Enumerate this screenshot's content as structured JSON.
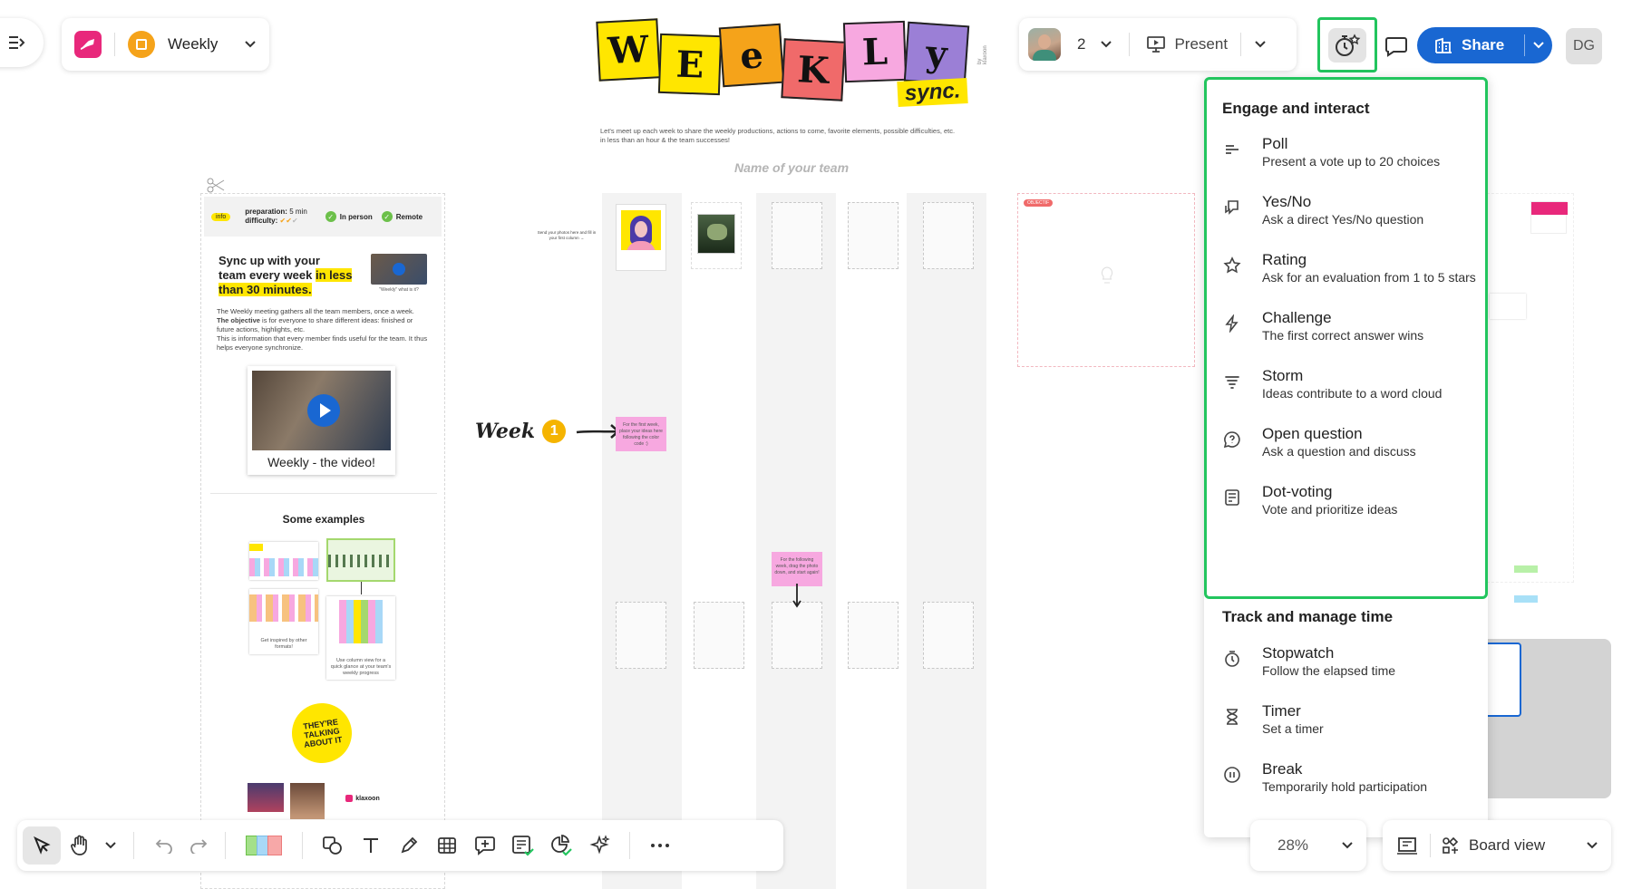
{
  "board": {
    "name": "Weekly"
  },
  "header": {
    "collaborators_count": "2",
    "present_label": "Present",
    "share_label": "Share",
    "user_initials": "DG"
  },
  "banner": {
    "letters": [
      "W",
      "E",
      "e",
      "K",
      "L",
      "y"
    ],
    "sync": "sync.",
    "credit": "by klaxoon",
    "intro_line1": "Let's meet up each week to share the weekly productions, actions to come, favorite elements, possible difficulties, etc.",
    "intro_line2": "in less than an hour & the team successes!",
    "team_placeholder": "Name of your team"
  },
  "info_panel": {
    "tag": "info",
    "prep_label": "preparation:",
    "prep_value": "5 min",
    "difficulty_label": "difficulty:",
    "in_person": "In person",
    "remote": "Remote",
    "headline_a": "Sync up with your",
    "headline_b": "team every week",
    "headline_c": "in less",
    "headline_d": "than 30 minutes.",
    "thumb_caption": "\"Weekly\" what is it?",
    "body1": "The Weekly meeting gathers all the team members, once a week.",
    "body2_bold": "The objective",
    "body2": "is for everyone to share different ideas: finished or future actions, highlights, etc.",
    "body3": "This is information that every member finds useful for the team. It thus helps everyone synchronize.",
    "video_caption": "Weekly - the video!",
    "examples_title": "Some examples",
    "ex_caption1": "Get inspired by other formats!",
    "ex_caption2": "Use column view for a quick glance at your team's weekly progress",
    "talking": "THEY'RE TALKING ABOUT IT",
    "klaxoon_logo": "klaxoon"
  },
  "canvas": {
    "week_label": "Week",
    "week_number": "1",
    "note_small": "Send your photos here and fill in your first column →",
    "sticky1": "For the first week, place your ideas here following the color code :)",
    "sticky2": "For the following week, drag the photo down, and start again!",
    "red_tag": "OBJECTIF"
  },
  "menu": {
    "section1": "Engage and interact",
    "section2": "Track and manage time",
    "engage": [
      {
        "icon": "poll-icon",
        "title": "Poll",
        "desc": "Present a vote up to 20 choices"
      },
      {
        "icon": "yes-no-icon",
        "title": "Yes/No",
        "desc": "Ask a direct Yes/No question"
      },
      {
        "icon": "star-icon",
        "title": "Rating",
        "desc": "Ask for an evaluation from 1 to 5 stars"
      },
      {
        "icon": "lightning-icon",
        "title": "Challenge",
        "desc": "The first correct answer wins"
      },
      {
        "icon": "storm-icon",
        "title": "Storm",
        "desc": "Ideas contribute to a word cloud"
      },
      {
        "icon": "question-icon",
        "title": "Open question",
        "desc": "Ask a question and discuss"
      },
      {
        "icon": "dot-voting-icon",
        "title": "Dot-voting",
        "desc": "Vote and prioritize ideas"
      }
    ],
    "time": [
      {
        "icon": "stopwatch-icon",
        "title": "Stopwatch",
        "desc": "Follow the elapsed time"
      },
      {
        "icon": "hourglass-icon",
        "title": "Timer",
        "desc": "Set a timer"
      },
      {
        "icon": "pause-icon",
        "title": "Break",
        "desc": "Temporarily hold participation"
      }
    ]
  },
  "bottom": {
    "zoom": "28%",
    "board_view": "Board view"
  },
  "colors": {
    "accent_blue": "#1967d2",
    "highlight_green": "#22c55e",
    "brand_pink": "#e8287b",
    "board_orange": "#f5a31a",
    "yellow": "#ffe600",
    "sticky_pink": "#f7a8e0"
  }
}
